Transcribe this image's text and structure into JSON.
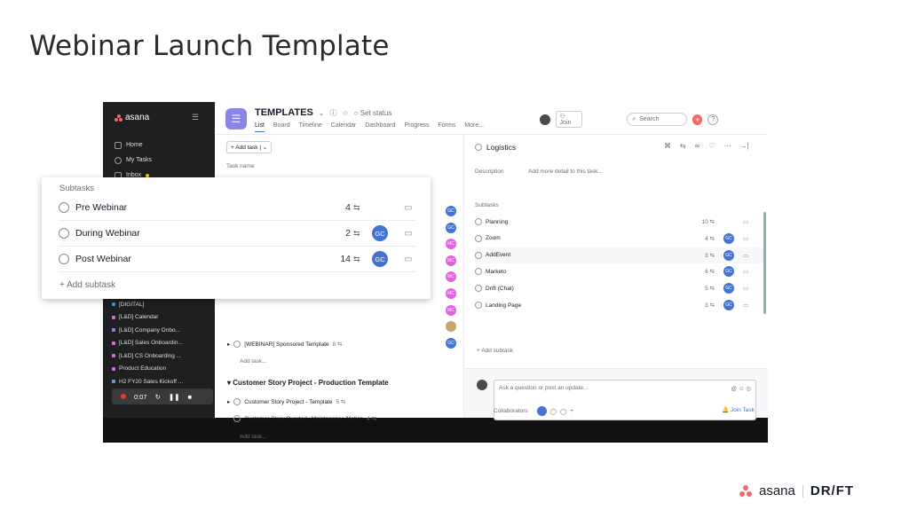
{
  "slide_title": "Webinar Launch Template",
  "sidebar": {
    "logo": "asana",
    "nav": [
      "Home",
      "My Tasks",
      "Inbox"
    ],
    "projects": [
      {
        "label": "[DIGITAL]",
        "color": "#21a3d1"
      },
      {
        "label": "[L&D] Calendar",
        "color": "#e362e3"
      },
      {
        "label": "[L&D] Company Onbo...",
        "color": "#8d84e8"
      },
      {
        "label": "[L&D] Sales Onboardin...",
        "color": "#e362e3"
      },
      {
        "label": "[L&D] CS Onboarding ...",
        "color": "#e362e3"
      },
      {
        "label": "Product Education",
        "color": "#e362e3"
      },
      {
        "label": "H2 FY20 Sales Kickoff ...",
        "color": "#8d84e8"
      }
    ],
    "video_time": "0:07"
  },
  "header": {
    "title": "TEMPLATES",
    "set_status": "Set status",
    "tabs": [
      "List",
      "Board",
      "Timeline",
      "Calendar",
      "Dashboard",
      "Progress",
      "Forms",
      "More..."
    ],
    "join": "Join",
    "search_placeholder": "Search",
    "help": "?"
  },
  "list": {
    "add_task": "+ Add task",
    "column_header": "Task name",
    "rows": [
      {
        "name": "[WEBINAR] Sponsored Template",
        "count": "8"
      }
    ],
    "add_task_link": "Add task...",
    "section2": "Customer Story Project - Production Template",
    "section2_rows": [
      {
        "name": "Customer Story Project - Template",
        "count": "5"
      },
      {
        "name": "Customer Story Quarterly Maintenance Motion",
        "count": "4"
      }
    ],
    "avatars": [
      {
        "initials": "GC",
        "color": "#4573d2"
      },
      {
        "initials": "GC",
        "color": "#4573d2"
      },
      {
        "initials": "MC",
        "color": "#e362e3"
      },
      {
        "initials": "MC",
        "color": "#e362e3"
      },
      {
        "initials": "MC",
        "color": "#e362e3"
      },
      {
        "initials": "MC",
        "color": "#e362e3"
      },
      {
        "initials": "MC",
        "color": "#e362e3"
      },
      {
        "initials": "",
        "color": "#c9a46b"
      },
      {
        "initials": "GC",
        "color": "#4573d2"
      }
    ]
  },
  "detail": {
    "title": "Logistics",
    "description_label": "Description",
    "description_placeholder": "Add more detail to this task...",
    "subtasks_label": "Subtasks",
    "subtasks": [
      {
        "name": "Planning",
        "count": "10",
        "avatar": ""
      },
      {
        "name": "Zoom",
        "count": "4",
        "avatar": "GC"
      },
      {
        "name": "AddEvent",
        "count": "3",
        "avatar": "GC"
      },
      {
        "name": "Marketo",
        "count": "6",
        "avatar": "GC"
      },
      {
        "name": "Drift (Chat)",
        "count": "5",
        "avatar": "GC"
      },
      {
        "name": "Landing Page",
        "count": "3",
        "avatar": "GC"
      }
    ],
    "add_subtask": "+ Add subtask",
    "comment_placeholder": "Ask a question or post an update...",
    "collaborators": "Collaborators",
    "join_task": "Join Task"
  },
  "popover": {
    "heading": "Subtasks",
    "rows": [
      {
        "name": "Pre Webinar",
        "count": "4",
        "avatar": ""
      },
      {
        "name": "During Webinar",
        "count": "2",
        "avatar": "GC"
      },
      {
        "name": "Post Webinar",
        "count": "14",
        "avatar": "GC"
      }
    ],
    "add_subtask": "+ Add subtask"
  },
  "footer": {
    "brand1": "asana",
    "brand2": "DR/FT"
  },
  "colors": {
    "accent": "#4573d2",
    "asana_coral": "#f06a6a",
    "sidebar_bg": "#1e1f21",
    "project_icon": "#8d84e8"
  }
}
